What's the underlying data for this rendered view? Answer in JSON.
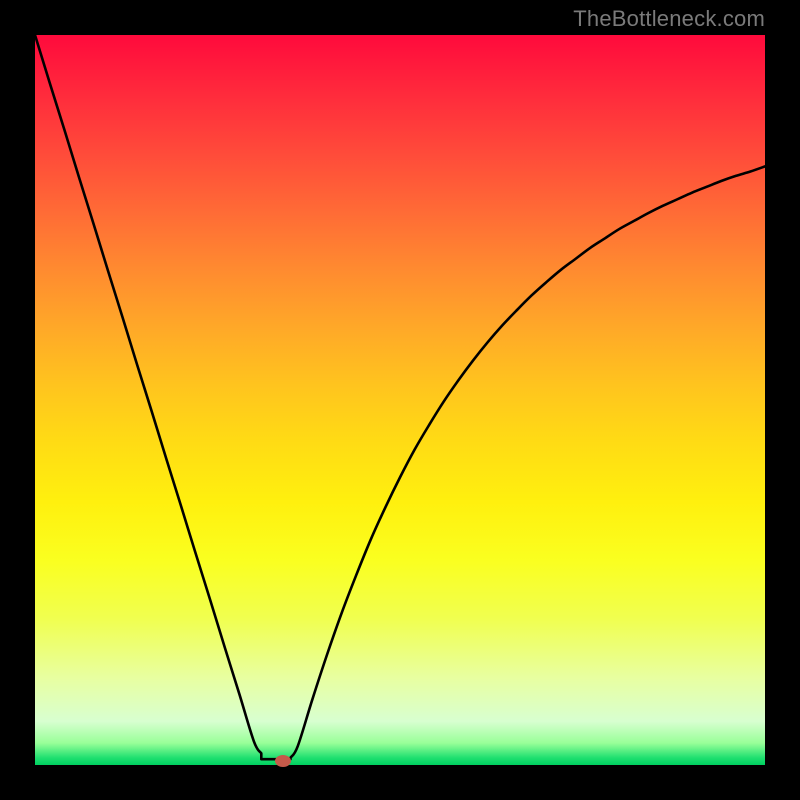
{
  "attribution": "TheBottleneck.com",
  "colors": {
    "top": "#ff0a3c",
    "bottom": "#00d060",
    "curve": "#000000",
    "marker": "#c55a4a",
    "frame": "#000000",
    "attribution_text": "#7a7a7a"
  },
  "chart_data": {
    "type": "line",
    "title": "",
    "xlabel": "",
    "ylabel": "",
    "xlim": [
      0,
      100
    ],
    "ylim": [
      0,
      100
    ],
    "grid": false,
    "legend": false,
    "x": [
      0,
      2,
      4,
      6,
      8,
      10,
      12,
      14,
      16,
      18,
      20,
      22,
      24,
      26,
      28,
      30,
      31,
      32,
      33,
      34,
      35,
      36,
      38,
      40,
      42,
      44,
      46,
      48,
      50,
      52,
      54,
      56,
      58,
      60,
      62,
      64,
      66,
      68,
      70,
      72,
      74,
      76,
      78,
      80,
      82,
      84,
      86,
      88,
      90,
      92,
      94,
      96,
      98,
      100
    ],
    "y": [
      100,
      93.5,
      87.1,
      80.6,
      74.2,
      67.7,
      61.3,
      54.8,
      48.4,
      41.9,
      35.5,
      29.0,
      22.6,
      16.1,
      9.7,
      3.2,
      1.6,
      1.0,
      0.6,
      0.6,
      1.0,
      2.6,
      9.0,
      15.1,
      20.8,
      26.0,
      30.9,
      35.3,
      39.4,
      43.2,
      46.6,
      49.8,
      52.7,
      55.4,
      57.9,
      60.2,
      62.3,
      64.3,
      66.1,
      67.8,
      69.3,
      70.8,
      72.1,
      73.4,
      74.5,
      75.6,
      76.6,
      77.5,
      78.4,
      79.2,
      80.0,
      80.7,
      81.3,
      82.0
    ],
    "marker": {
      "x": 34,
      "y": 0.6
    },
    "flat_segment": {
      "x_start": 31,
      "x_end": 35,
      "y": 0.8
    },
    "annotations": []
  }
}
